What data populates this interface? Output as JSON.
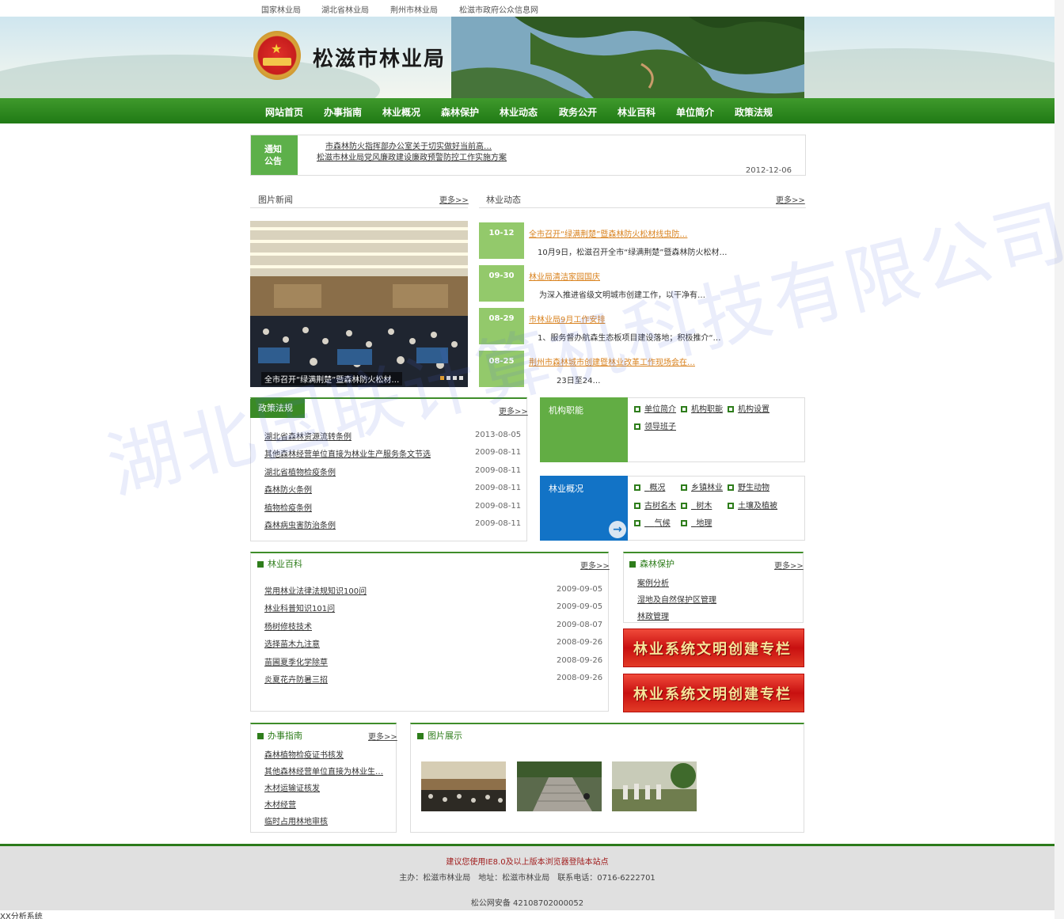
{
  "top_links": [
    "国家林业局",
    "湖北省林业局",
    "荆州市林业局",
    "松滋市政府公众信息网"
  ],
  "site": {
    "title": "松滋市林业局"
  },
  "nav": [
    "网站首页",
    "办事指南",
    "林业概况",
    "森林保护",
    "林业动态",
    "政务公开",
    "林业百科",
    "单位简介",
    "政策法规"
  ],
  "notice": {
    "tag_line1": "通知",
    "tag_line2": "公告",
    "lines": [
      "市森林防火指挥部办公室关于切实做好当前高…",
      "松滋市林业局党风廉政建设廉政预警防控工作实施方案"
    ],
    "date": "2012-12-06"
  },
  "photo_news": {
    "title": "图片新闻",
    "more": "更多>>",
    "caption": "全市召开“绿满荆楚”暨森林防火松材…"
  },
  "forestry_news": {
    "title": "林业动态",
    "more": "更多>>",
    "items": [
      {
        "date": "10-12",
        "title": "全市召开“绿满荆楚”暨森林防火松材线虫防…",
        "summary": "10月9日，松滋召开全市“绿满荆楚”暨森林防火松材…"
      },
      {
        "date": "09-30",
        "title": "林业局清洁家园国庆",
        "summary": "为深入推进省级文明城市创建工作，以干净有…"
      },
      {
        "date": "08-29",
        "title": "市林业局9月工作安排",
        "summary": "1、服务督办航森生态板项目建设落地；积极推介“…"
      },
      {
        "date": "08-25",
        "title": "荆州市森林城市创建暨林业改革工作现场会在…",
        "summary": "23日至24…"
      }
    ]
  },
  "policy": {
    "title": "政策法规",
    "more": "更多>>",
    "items": [
      {
        "title": "湖北省森林资源流转条例",
        "date": "2013-08-05"
      },
      {
        "title": "其他森林经营单位直接为林业生产服务条文节选",
        "date": "2009-08-11"
      },
      {
        "title": "湖北省植物检疫条例",
        "date": "2009-08-11"
      },
      {
        "title": "森林防火条例",
        "date": "2009-08-11"
      },
      {
        "title": "植物检疫条例",
        "date": "2009-08-11"
      },
      {
        "title": "森林病虫害防治条例",
        "date": "2009-08-11"
      }
    ]
  },
  "org_function": {
    "title": "机构职能",
    "links": [
      "单位简介",
      "机构职能",
      "机构设置",
      "领导班子"
    ]
  },
  "overview": {
    "title": "林业概况",
    "links": [
      "概况",
      "乡镇林业",
      "野生动物",
      "古树名木",
      "树木",
      "土壤及植被",
      "气候",
      "地理"
    ]
  },
  "encyclopedia": {
    "title": "林业百科",
    "more": "更多>>",
    "items": [
      {
        "title": "常用林业法律法规知识100问",
        "date": "2009-09-05"
      },
      {
        "title": "林业科普知识101问",
        "date": "2009-09-05"
      },
      {
        "title": "杨树修枝技术",
        "date": "2009-08-07"
      },
      {
        "title": "选择苗木九注意",
        "date": "2008-09-26"
      },
      {
        "title": "苗圃夏季化学除草",
        "date": "2008-09-26"
      },
      {
        "title": "炎夏花卉防暑三招",
        "date": "2008-09-26"
      }
    ]
  },
  "forest_protection": {
    "title": "森林保护",
    "more": "更多>>",
    "items": [
      "案例分析",
      "湿地及自然保护区管理",
      "林政管理"
    ]
  },
  "ribbon": {
    "label": "林业系统文明创建专栏"
  },
  "guide": {
    "title": "办事指南",
    "more": "更多>>",
    "items": [
      "森林植物检疫证书核发",
      "其他森林经营单位直接为林业生…",
      "木材运输证核发",
      "木材经营",
      "临时占用林地审核"
    ]
  },
  "gallery": {
    "title": "图片展示"
  },
  "footer": {
    "browser_tip": "建议您使用IE8.0及以上版本浏览器登陆本站点",
    "info": "主办：松滋市林业局　地址：松滋市林业局　联系电话：0716-6222701",
    "record": "松公网安备 42108702000052"
  },
  "status_bar": "XX分析系统",
  "watermark": "湖北国联计算机科技有限公司",
  "colors": {
    "nav_green": "#2b8a1e",
    "accent_orange": "#d9821e",
    "date_box": "#93c96b",
    "blue_panel": "#1273c6",
    "footer_red": "#a01c1c"
  }
}
